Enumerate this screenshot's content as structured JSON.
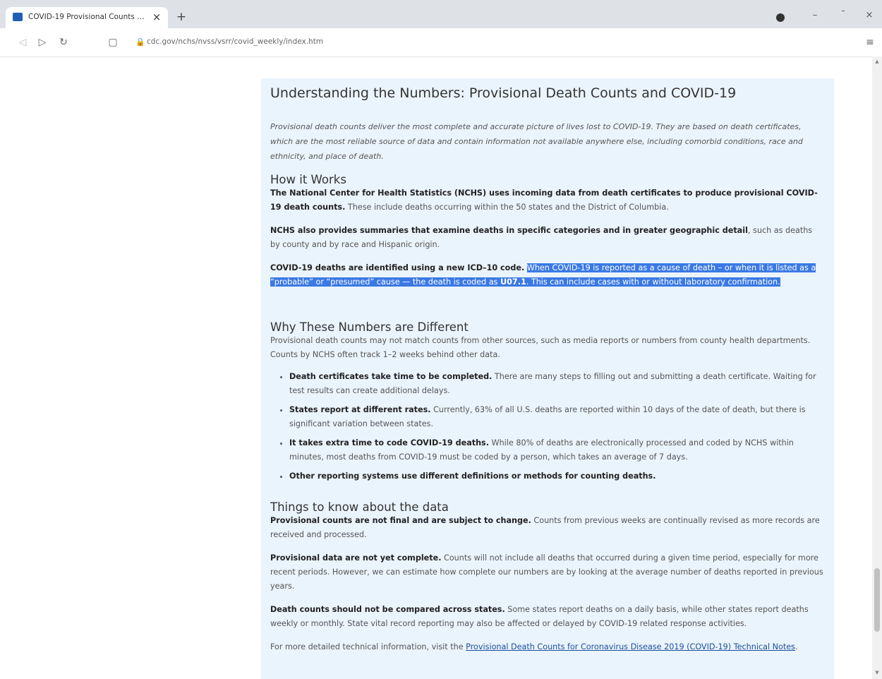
{
  "browser": {
    "tab_title": "COVID-19 Provisional Counts - W",
    "url": "cdc.gov/nchs/nvss/vsrr/covid_weekly/index.htm"
  },
  "card": {
    "title": "Understanding the Numbers: Provisional Death Counts and COVID-19",
    "intro": "Provisional death counts deliver the most complete and accurate picture of lives lost to COVID-19. They are based on death certificates, which are the most reliable source of data and contain information not available anywhere else, including comorbid conditions, race and ethnicity, and place of death."
  },
  "how_it_works": {
    "heading": "How it Works",
    "p1_bold": "The National Center for Health Statistics (NCHS) uses incoming data from death certificates to produce provisional COVID-19 death counts.",
    "p1_rest": " These include deaths occurring within the 50 states and the District of Columbia.",
    "p2_bold": "NCHS also provides summaries that examine deaths in specific categories and in greater geographic detail",
    "p2_rest": ", such as deaths by county and by race and Hispanic origin.",
    "p3_bold": "COVID-19 deaths are identified using a new ICD–10 code.",
    "p3_sel_a": "When COVID-19 is reported as a cause of death – or when it is listed as a “probable” or “presumed” cause — the death is coded as ",
    "p3_sel_code": "U07.1",
    "p3_sel_b": ". This can include cases with or without laboratory confirmation."
  },
  "why_different": {
    "heading": "Why These Numbers are Different",
    "intro": "Provisional death counts may not match counts from other sources, such as media reports or numbers from county health departments. Counts by NCHS often track 1–2 weeks behind other data.",
    "items": [
      {
        "bold": "Death certificates take time to be completed.",
        "rest": " There are many steps to filling out and submitting a death certificate. Waiting for test results can create additional delays."
      },
      {
        "bold": "States report at different rates.",
        "rest": " Currently, 63% of all U.S. deaths are reported within 10 days of the date of death, but there is significant variation between states."
      },
      {
        "bold": "It takes extra time to code COVID-19 deaths.",
        "rest": " While 80% of deaths are electronically processed and coded by NCHS within minutes, most deaths from COVID-19 must be coded by a person, which takes an average of 7 days."
      },
      {
        "bold": "Other reporting systems use different definitions or methods for counting deaths.",
        "rest": ""
      }
    ]
  },
  "things_to_know": {
    "heading": "Things to know about the data",
    "p1_bold": "Provisional counts are not final and are subject to change.",
    "p1_rest": " Counts from previous weeks are continually revised as more records are received and processed.",
    "p2_bold": "Provisional data are not yet complete.",
    "p2_rest": " Counts will not include all deaths that occurred during a given time period, especially for more recent periods. However, we can estimate how complete our numbers are by looking at the average number of deaths reported in previous years.",
    "p3_bold": "Death counts should not be compared across states.",
    "p3_rest": " Some states report deaths on a daily basis, while other states report deaths weekly or monthly. State vital record reporting may also be affected or delayed by COVID-19 related response activities.",
    "p4_text": "For more detailed technical information, visit the ",
    "p4_link": "Provisional Death Counts for Coronavirus Disease 2019 (COVID-19) Technical Notes",
    "p4_end": "."
  }
}
